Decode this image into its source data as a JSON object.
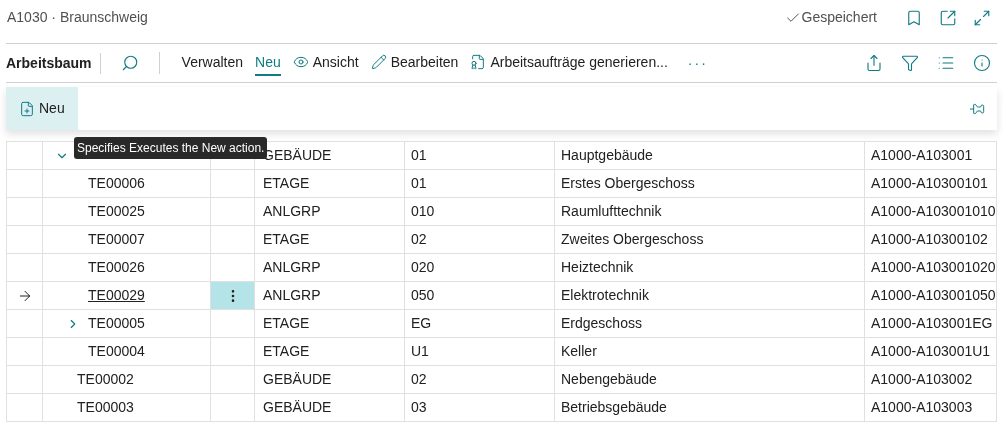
{
  "header": {
    "title": "A1030 · Braunschweig",
    "status": "Gespeichert"
  },
  "toolbar": {
    "page_name": "Arbeitsbaum",
    "actions": [
      {
        "label": "Verwalten",
        "selected": false
      },
      {
        "label": "Neu",
        "selected": true
      },
      {
        "label": "Ansicht",
        "selected": false
      },
      {
        "label": "Bearbeiten",
        "selected": false
      },
      {
        "label": "Arbeitsaufträge generieren...",
        "selected": false
      }
    ],
    "more": "···"
  },
  "action_panel": {
    "button": "Neu"
  },
  "tooltip": "Specifies Executes the New action.",
  "table": {
    "rows": [
      {
        "type": "GEBÄUDE",
        "code": "01",
        "name": "Hauptgebäude",
        "path": "A1000-A103001",
        "current": false,
        "expanded": true,
        "children": [
          {
            "id": "TE00006",
            "type": "ETAGE",
            "code": "01",
            "name": "Erstes Obergeschoss",
            "path": "A1000-A10300101",
            "current": false
          },
          {
            "id": "TE00025",
            "type": "ANLGRP",
            "code": "010",
            "name": "Raumlufttechnik",
            "path": "A1000-A103001010",
            "current": false
          },
          {
            "id": "TE00007",
            "type": "ETAGE",
            "code": "02",
            "name": "Zweites Obergeschoss",
            "path": "A1000-A10300102",
            "current": false
          },
          {
            "id": "TE00026",
            "type": "ANLGRP",
            "code": "020",
            "name": "Heiztechnik",
            "path": "A1000-A103001020",
            "current": false
          },
          {
            "id": "TE00029",
            "type": "ANLGRP",
            "code": "050",
            "name": "Elektrotechnik",
            "path": "A1000-A103001050",
            "current": true
          },
          {
            "id": "TE00005",
            "type": "ETAGE",
            "code": "EG",
            "name": "Erdgeschoss",
            "path": "A1000-A103001EG",
            "current": false,
            "expanded": false
          },
          {
            "id": "TE00004",
            "type": "ETAGE",
            "code": "U1",
            "name": "Keller",
            "path": "A1000-A103001U1",
            "current": false
          }
        ]
      },
      {
        "id": "TE00002",
        "type": "GEBÄUDE",
        "code": "02",
        "name": "Nebengebäude",
        "path": "A1000-A103002",
        "current": false
      },
      {
        "id": "TE00003",
        "type": "GEBÄUDE",
        "code": "03",
        "name": "Betriebsgebäude",
        "path": "A1000-A103003",
        "current": false
      }
    ]
  }
}
